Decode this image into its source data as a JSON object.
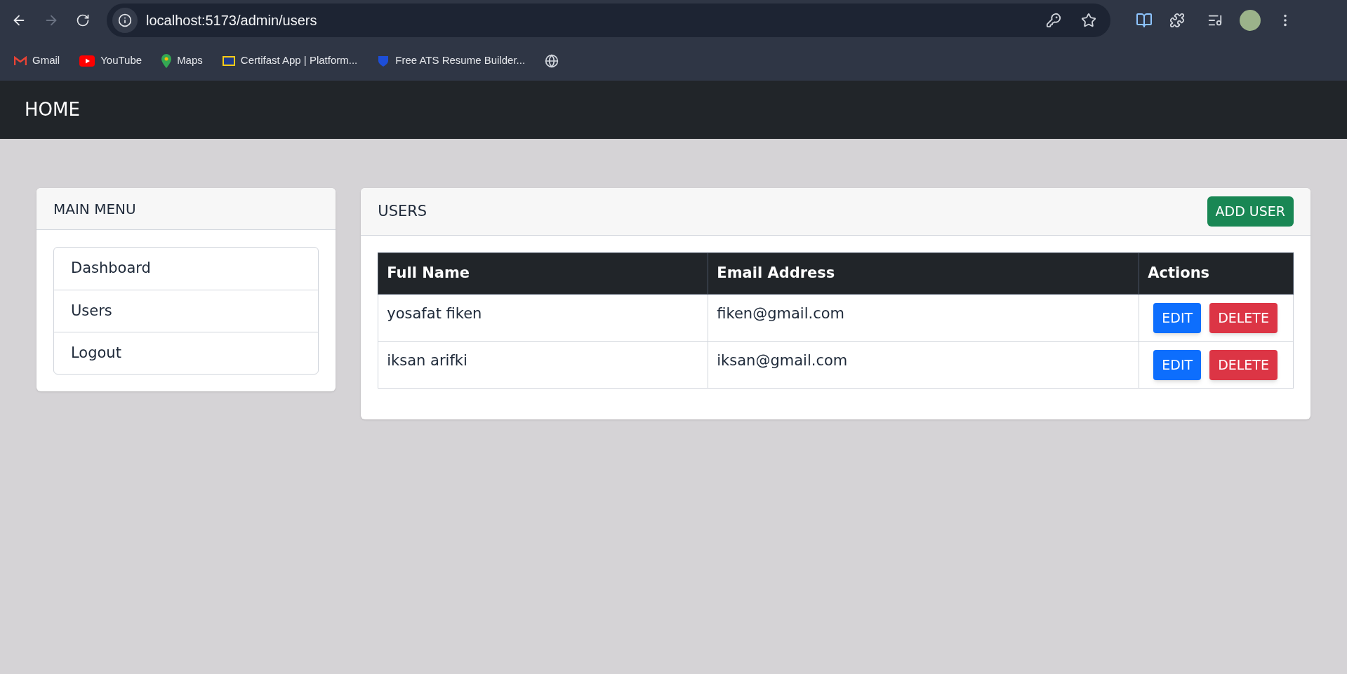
{
  "browser": {
    "url": "localhost:5173/admin/users",
    "bookmarks": [
      {
        "label": "Gmail",
        "kind": "gmail"
      },
      {
        "label": "YouTube",
        "kind": "youtube"
      },
      {
        "label": "Maps",
        "kind": "maps"
      },
      {
        "label": "Certifast App | Platform...",
        "kind": "certifast"
      },
      {
        "label": "Free ATS Resume Builder...",
        "kind": "resume"
      },
      {
        "kind": "globe"
      }
    ]
  },
  "navbar": {
    "brand": "HOME"
  },
  "sidebar": {
    "title": "MAIN MENU",
    "items": [
      "Dashboard",
      "Users",
      "Logout"
    ]
  },
  "users": {
    "title": "USERS",
    "add_button": "ADD USER",
    "columns": [
      "Full Name",
      "Email Address",
      "Actions"
    ],
    "rows": [
      {
        "name": "yosafat fiken",
        "email": "fiken@gmail.com",
        "edit": "EDIT",
        "delete": "DELETE"
      },
      {
        "name": "iksan arifki",
        "email": "iksan@gmail.com",
        "edit": "EDIT",
        "delete": "DELETE"
      }
    ]
  }
}
